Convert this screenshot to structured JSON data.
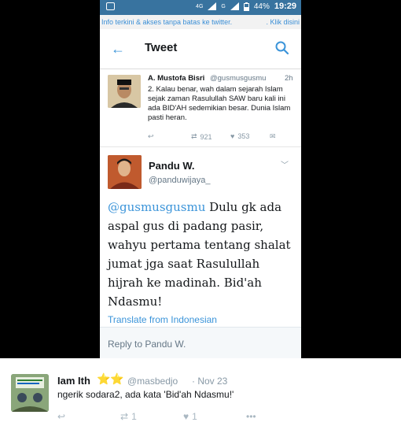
{
  "statusbar": {
    "network": "4G",
    "network2": "G",
    "battery": "44%",
    "time": "19:29"
  },
  "promo": {
    "left": "Info terkini & akses tanpa batas ke twitter.",
    "right": ". Klik disini"
  },
  "appbar": {
    "title": "Tweet"
  },
  "quoted_tweet": {
    "name": "A. Mustofa Bisri",
    "handle": "@gusmusgusmu",
    "time": "2h",
    "text": "2. Kalau benar, wah dalam sejarah Islam sejak zaman Rasulullah SAW baru kali ini ada BID'AH sedemikian besar. Dunia Islam pasti heran.",
    "retweets": "921",
    "likes": "353"
  },
  "main_tweet": {
    "name": "Pandu W.",
    "handle": "@panduwijaya_",
    "mention": "@gusmusgusmu",
    "text": " Dulu gk ada aspal gus di padang pasir, wahyu pertama tentang shalat jumat jga saat Rasulullah hijrah ke madinah. Bid'ah Ndasmu!",
    "translate": "Translate from Indonesian",
    "reply_placeholder": "Reply to Pandu W."
  },
  "outer_tweet": {
    "name": "Iam Ith",
    "stars": "⭐⭐",
    "handle": "@masbedjo",
    "date": "· Nov 23",
    "text": "ngerik sodara2, ada kata 'Bid'ah Ndasmu!'",
    "retweets": "1",
    "likes": "1"
  },
  "colors": {
    "twitter_blue": "#3b94d9",
    "statusbar": "#38739f",
    "star": "#f5a623"
  }
}
